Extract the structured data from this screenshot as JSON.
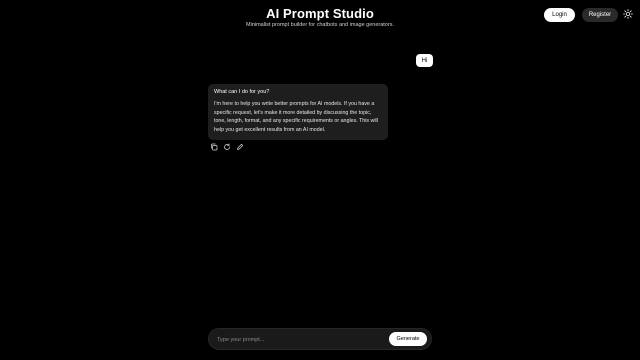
{
  "header": {
    "title": "AI Prompt Studio",
    "subtitle": "Minimalist prompt builder for chatbots and image generators.",
    "login_label": "Login",
    "register_label": "Register",
    "theme_icon": "sun-icon"
  },
  "chat": {
    "user_message": "Hi",
    "assistant_question": "What can I do for you?",
    "assistant_message": "I'm here to help you write better prompts for AI models. If you have a specific request, let's make it more detailed by discussing the topic, tone, length, format, and any specific requirements or angles. This will help you get excellent results from an AI model.",
    "actions": [
      "copy-icon",
      "regenerate-icon",
      "edit-icon"
    ]
  },
  "composer": {
    "placeholder": "Type your prompt...",
    "generate_label": "Generate"
  },
  "colors": {
    "background": "#000000",
    "bubble": "#1e1e1e",
    "primary_button": "#ffffff",
    "secondary_button": "#2a2a2a"
  }
}
